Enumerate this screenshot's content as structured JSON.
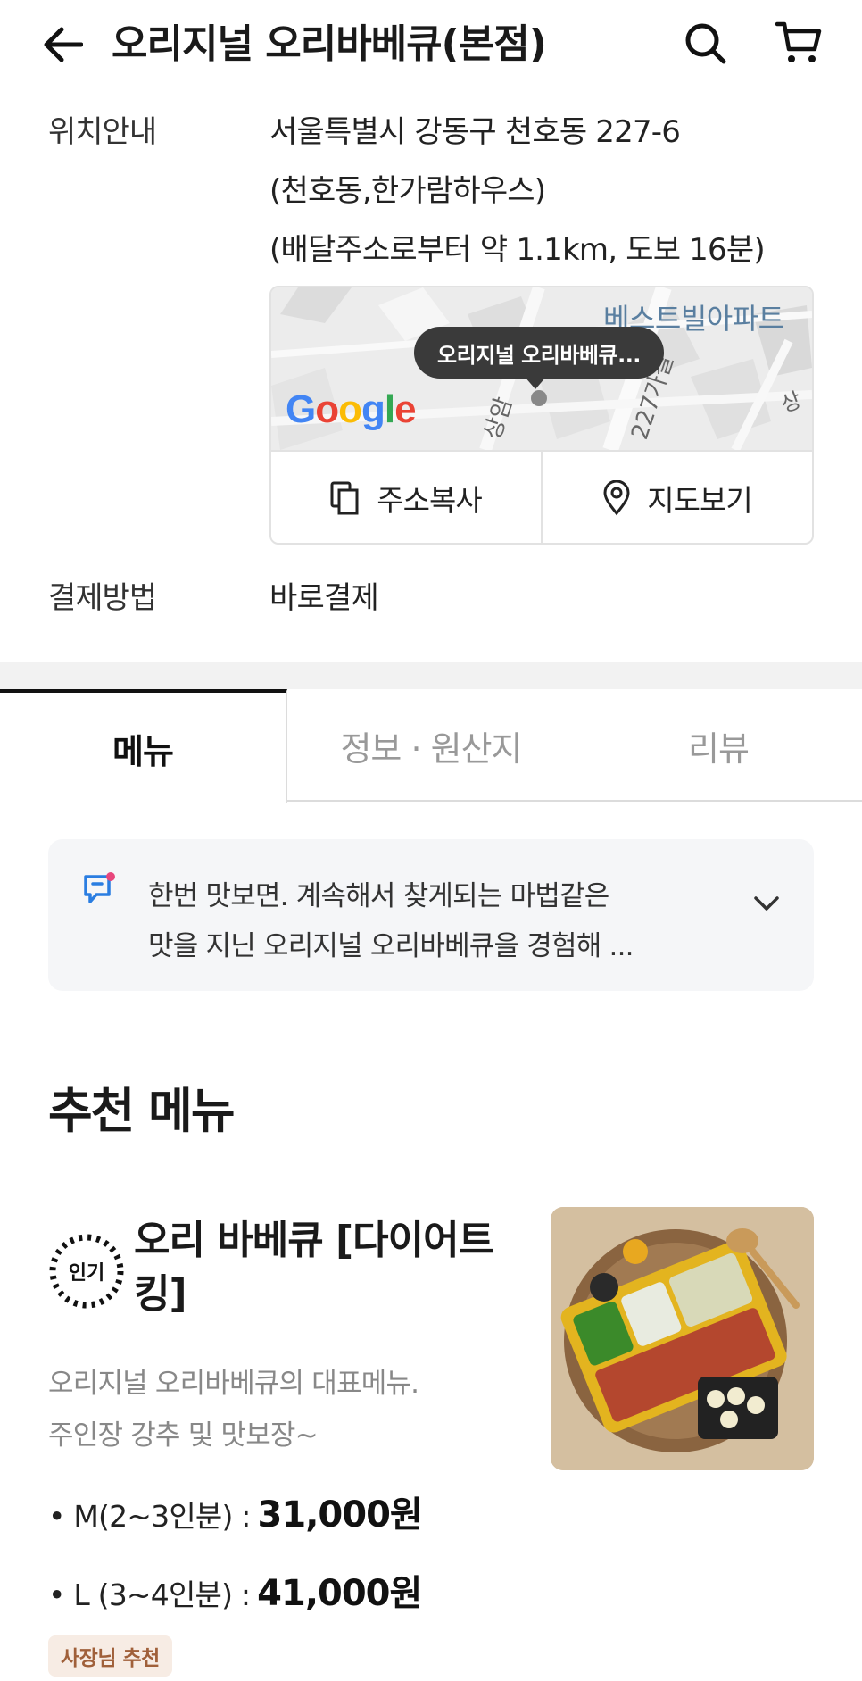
{
  "header": {
    "title": "오리지널 오리바베큐(본점)",
    "back_icon": "arrow-left-icon",
    "search_icon": "search-icon",
    "cart_icon": "cart-icon"
  },
  "location": {
    "label": "위치안내",
    "address_line1": "서울특별시 강동구 천호동 227-6",
    "address_line2": "(천호동,한가람하우스)",
    "distance": "(배달주소로부터 약 1.1km, 도보 16분)"
  },
  "map": {
    "tooltip": "오리지널 오리바베큐...",
    "poi": "베스트빌아파트",
    "logo": "Google",
    "copy_label": "주소복사",
    "view_label": "지도보기"
  },
  "payment": {
    "label": "결제방법",
    "value": "바로결제"
  },
  "tabs": [
    {
      "label": "메뉴",
      "active": true
    },
    {
      "label": "정보 · 원산지",
      "active": false
    },
    {
      "label": "리뷰",
      "active": false
    }
  ],
  "notice": {
    "line1": "한번 맛보면. 계속해서 찾게되는 마법같은",
    "line2": "맛을 지닌 오리지널 오리바베큐을 경험해 ..."
  },
  "section": {
    "title": "추천 메뉴"
  },
  "menu_item": {
    "badge": "인기",
    "name": "오리 바베큐 [다이어트킹]",
    "desc_line1": "오리지널 오리바베큐의 대표메뉴.",
    "desc_line2": "주인장 강추 및 맛보장~",
    "prices": [
      {
        "option": "• M(2~3인분) :",
        "price": "31,000원"
      },
      {
        "option": "• L  (3~4인분) :",
        "price": "41,000원"
      }
    ],
    "owner_badge": "사장님 추천"
  },
  "colors": {
    "accent_notice_icon": "#2a7de1",
    "notice_dot": "#e8467c",
    "owner_badge_bg": "#f7ece4",
    "owner_badge_text": "#a0603a"
  }
}
